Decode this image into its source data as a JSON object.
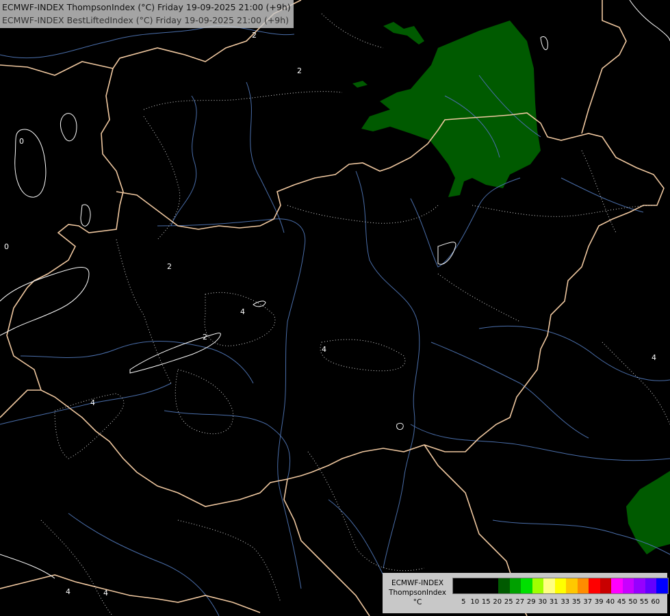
{
  "title": {
    "line1": "ECMWF-INDEX ThompsonIndex (°C) Friday 19-09-2025 21:00 (+9h)",
    "line2": "ECMWF-INDEX BestLiftedIndex (°C) Friday 19-09-2025 21:00 (+9h)"
  },
  "legend": {
    "line1": "ECMWF-INDEX",
    "line2": "ThompsonIndex",
    "line3": "°C",
    "colors": [
      "#000000",
      "#000000",
      "#000000",
      "#000000",
      "#005a00",
      "#00a000",
      "#00e000",
      "#a0ff00",
      "#ffff80",
      "#ffff00",
      "#ffc800",
      "#ff8c00",
      "#ff0000",
      "#c80000",
      "#ff00ff",
      "#c800ff",
      "#9600ff",
      "#6400ff",
      "#0000ff"
    ],
    "ticks": [
      "5",
      "10",
      "15",
      "20",
      "25",
      "27",
      "29",
      "30",
      "31",
      "33",
      "35",
      "37",
      "39",
      "40",
      "45",
      "50",
      "55",
      "60"
    ]
  },
  "contour_labels": [
    "2",
    "2",
    "0",
    "0",
    "2",
    "4",
    "2",
    "4",
    "4",
    "4",
    "4",
    "4"
  ]
}
